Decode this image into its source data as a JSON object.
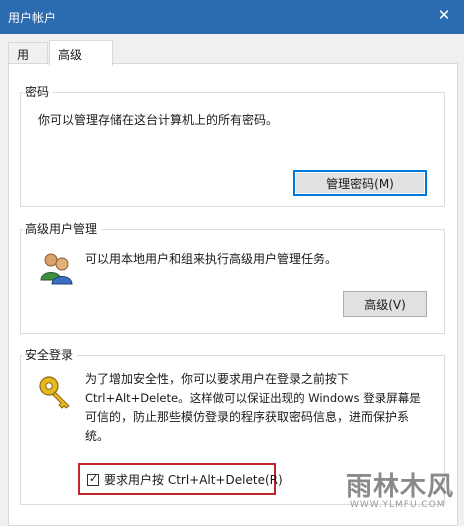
{
  "window": {
    "title": "用户帐户",
    "close_glyph": "✕"
  },
  "tabs": [
    {
      "label": "用户"
    },
    {
      "label": "高级"
    }
  ],
  "password_group": {
    "title": "密码",
    "description": "你可以管理存储在这台计算机上的所有密码。",
    "button_label": "管理密码(M)"
  },
  "advanced_group": {
    "title": "高级用户管理",
    "description": "可以用本地用户和组来执行高级用户管理任务。",
    "button_label": "高级(V)",
    "icon": "users-icon"
  },
  "secure_logon_group": {
    "title": "安全登录",
    "description_lines": [
      "为了增加安全性，你可以要求用户在登录之前按下",
      "Ctrl+Alt+Delete。这样做可以保证出现的 Windows 登录屏幕是",
      "可信的，防止那些模仿登录的程序获取密码信息，进而保护系",
      "统。"
    ],
    "icon": "key-icon",
    "checkbox_label": "要求用户按 Ctrl+Alt+Delete(R)",
    "checkbox_checked": true,
    "highlight_color": "#c0272d"
  },
  "watermark": {
    "main": "雨林木风",
    "sub": "WWW.YLMFU.COM"
  },
  "colors": {
    "titlebar": "#2b6bb0",
    "default_button_border": "#0078d7"
  }
}
